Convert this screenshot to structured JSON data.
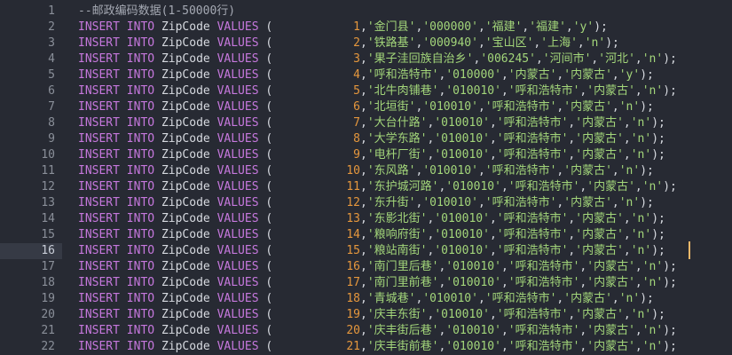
{
  "editor": {
    "current_line": 16,
    "comment": "--邮政编码数据(1-50000行)",
    "statement_prefix": {
      "insert": "INSERT",
      "into": "INTO",
      "table": "ZipCode",
      "values": "VALUES",
      "open": "("
    },
    "rows": [
      {
        "n": "1",
        "place": "'金门县'",
        "zip": "'000000'",
        "a": "'福建'",
        "b": "'福建'",
        "flag": "'y'"
      },
      {
        "n": "2",
        "place": "'铁路基'",
        "zip": "'000940'",
        "a": "'宝山区'",
        "b": "'上海'",
        "flag": "'n'"
      },
      {
        "n": "3",
        "place": "'果子洼回族自治乡'",
        "zip": "'006245'",
        "a": "'河间市'",
        "b": "'河北'",
        "flag": "'n'"
      },
      {
        "n": "4",
        "place": "'呼和浩特市'",
        "zip": "'010000'",
        "a": "'内蒙古'",
        "b": "'内蒙古'",
        "flag": "'y'"
      },
      {
        "n": "5",
        "place": "'北牛肉铺巷'",
        "zip": "'010010'",
        "a": "'呼和浩特市'",
        "b": "'内蒙古'",
        "flag": "'n'"
      },
      {
        "n": "6",
        "place": "'北垣街'",
        "zip": "'010010'",
        "a": "'呼和浩特市'",
        "b": "'内蒙古'",
        "flag": "'n'"
      },
      {
        "n": "7",
        "place": "'大台什路'",
        "zip": "'010010'",
        "a": "'呼和浩特市'",
        "b": "'内蒙古'",
        "flag": "'n'"
      },
      {
        "n": "8",
        "place": "'大学东路'",
        "zip": "'010010'",
        "a": "'呼和浩特市'",
        "b": "'内蒙古'",
        "flag": "'n'"
      },
      {
        "n": "9",
        "place": "'电杆厂街'",
        "zip": "'010010'",
        "a": "'呼和浩特市'",
        "b": "'内蒙古'",
        "flag": "'n'"
      },
      {
        "n": "10",
        "place": "'东风路'",
        "zip": "'010010'",
        "a": "'呼和浩特市'",
        "b": "'内蒙古'",
        "flag": "'n'"
      },
      {
        "n": "11",
        "place": "'东护城河路'",
        "zip": "'010010'",
        "a": "'呼和浩特市'",
        "b": "'内蒙古'",
        "flag": "'n'"
      },
      {
        "n": "12",
        "place": "'东升街'",
        "zip": "'010010'",
        "a": "'呼和浩特市'",
        "b": "'内蒙古'",
        "flag": "'n'"
      },
      {
        "n": "13",
        "place": "'东影北街'",
        "zip": "'010010'",
        "a": "'呼和浩特市'",
        "b": "'内蒙古'",
        "flag": "'n'"
      },
      {
        "n": "14",
        "place": "'粮响府街'",
        "zip": "'010010'",
        "a": "'呼和浩特市'",
        "b": "'内蒙古'",
        "flag": "'n'"
      },
      {
        "n": "15",
        "place": "'粮站南街'",
        "zip": "'010010'",
        "a": "'呼和浩特市'",
        "b": "'内蒙古'",
        "flag": "'n'"
      },
      {
        "n": "16",
        "place": "'南门里后巷'",
        "zip": "'010010'",
        "a": "'呼和浩特市'",
        "b": "'内蒙古'",
        "flag": "'n'"
      },
      {
        "n": "17",
        "place": "'南门里前巷'",
        "zip": "'010010'",
        "a": "'呼和浩特市'",
        "b": "'内蒙古'",
        "flag": "'n'"
      },
      {
        "n": "18",
        "place": "'青城巷'",
        "zip": "'010010'",
        "a": "'呼和浩特市'",
        "b": "'内蒙古'",
        "flag": "'n'"
      },
      {
        "n": "19",
        "place": "'庆丰东街'",
        "zip": "'010010'",
        "a": "'呼和浩特市'",
        "b": "'内蒙古'",
        "flag": "'n'"
      },
      {
        "n": "20",
        "place": "'庆丰街后巷'",
        "zip": "'010010'",
        "a": "'呼和浩特市'",
        "b": "'内蒙古'",
        "flag": "'n'"
      },
      {
        "n": "21",
        "place": "'庆丰街前巷'",
        "zip": "'010010'",
        "a": "'呼和浩特市'",
        "b": "'内蒙古'",
        "flag": "'n'"
      }
    ]
  }
}
